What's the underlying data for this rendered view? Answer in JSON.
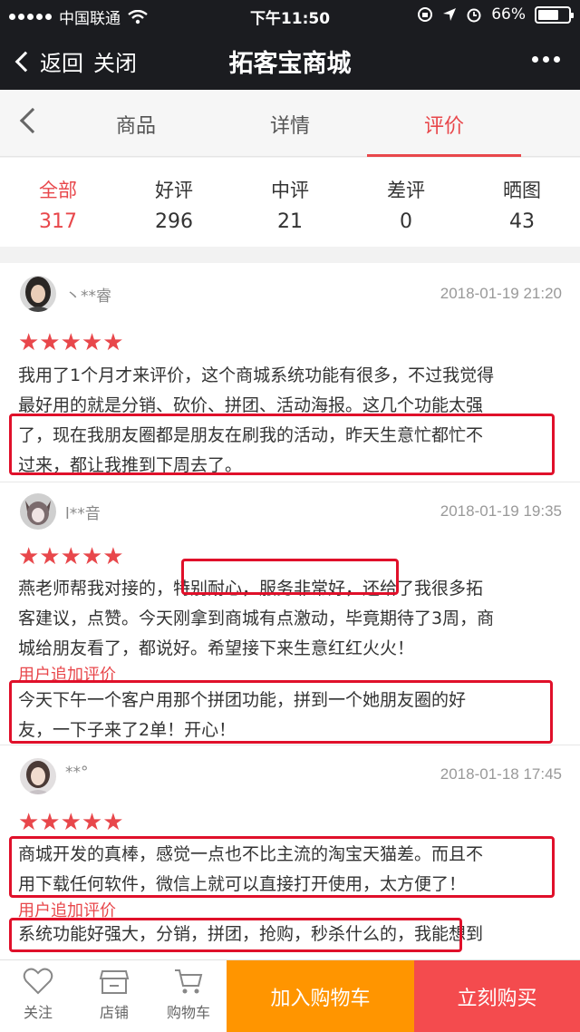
{
  "status": {
    "carrier": "中国联通",
    "time": "下午11:50",
    "battery": "66%"
  },
  "nav": {
    "back_label": "返回",
    "close_label": "关闭",
    "title": "拓客宝商城"
  },
  "tabs": [
    {
      "label": "商品"
    },
    {
      "label": "详情"
    },
    {
      "label": "评价"
    }
  ],
  "filters": [
    {
      "label": "全部",
      "count": "317"
    },
    {
      "label": "好评",
      "count": "296"
    },
    {
      "label": "中评",
      "count": "21"
    },
    {
      "label": "差评",
      "count": "0"
    },
    {
      "label": "晒图",
      "count": "43"
    }
  ],
  "reviews": [
    {
      "user": "丶**睿",
      "date": "2018-01-19 21:20",
      "stars": "★★★★★",
      "lines": [
        "我用了1个月才来评价，这个商城系统功能有很多，不过我觉得",
        "最好用的就是分销、砍价、拼团、活动海报。这几个功能太强",
        "了，现在我朋友圈都是朋友在刷我的活动，昨天生意忙都忙不",
        "过来，都让我推到下周去了。"
      ]
    },
    {
      "user": "l**音",
      "date": "2018-01-19 19:35",
      "stars": "★★★★★",
      "lines": [
        "燕老师帮我对接的，特别耐心，服务非常好，还给了我很多拓",
        "客建议，点赞。今天刚拿到商城有点激动，毕竟期待了3周，商",
        "城给朋友看了，都说好。希望接下来生意红红火火！"
      ],
      "additional_label": "用户追加评价",
      "additional_lines": [
        "今天下午一个客户用那个拼团功能，拼到一个她朋友圈的好",
        "友，一下子来了2单！开心！"
      ]
    },
    {
      "user": "**°",
      "date": "2018-01-18 17:45",
      "stars": "★★★★★",
      "lines": [
        "商城开发的真棒，感觉一点也不比主流的淘宝天猫差。而且不",
        "用下载任何软件，微信上就可以直接打开使用，太方便了！"
      ],
      "additional_label": "用户追加评价",
      "additional_lines": [
        "系统功能好强大，分销，拼团，抢购，秒杀什么的，我能想到"
      ]
    }
  ],
  "bottom": {
    "follow_label": "关注",
    "shop_label": "店铺",
    "cart_label": "购物车",
    "add_to_cart": "加入购物车",
    "buy_now": "立刻购买"
  },
  "colors": {
    "accent": "#e8474b",
    "cart_button": "#ff9500",
    "buy_button": "#f44b4e",
    "header": "#1b1c20",
    "highlight_box": "#e0102a"
  }
}
